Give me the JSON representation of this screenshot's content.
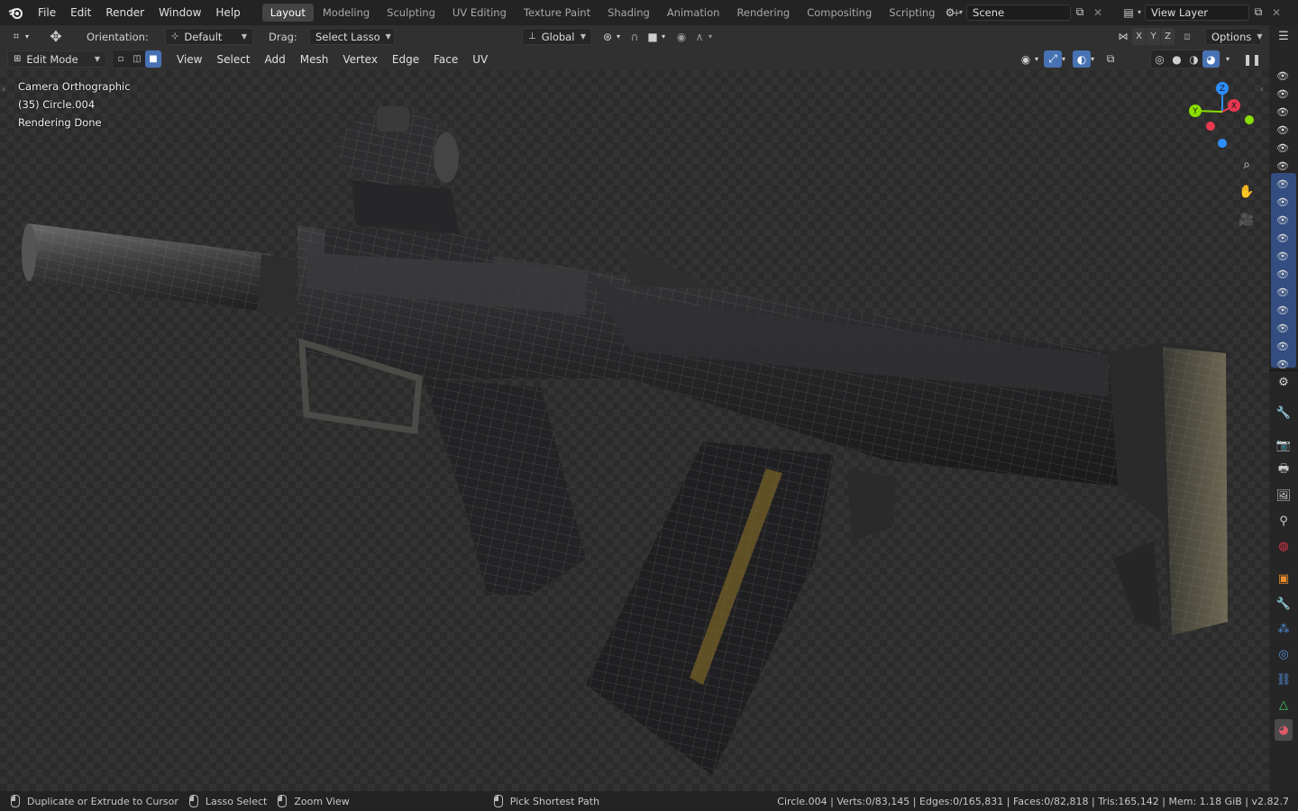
{
  "topbar": {
    "menus": [
      "File",
      "Edit",
      "Render",
      "Window",
      "Help"
    ],
    "workspace_tabs": [
      "Layout",
      "Modeling",
      "Sculpting",
      "UV Editing",
      "Texture Paint",
      "Shading",
      "Animation",
      "Rendering",
      "Compositing",
      "Scripting"
    ],
    "active_tab": "Layout",
    "add_tab": "+",
    "scene_name": "Scene",
    "view_layer_name": "View Layer"
  },
  "tool_header": {
    "orientation_label": "Orientation:",
    "orientation_value": "Default",
    "drag_label": "Drag:",
    "drag_value": "Select Lasso",
    "transform_orientation": "Global",
    "axes": [
      "X",
      "Y",
      "Z"
    ],
    "options_label": "Options"
  },
  "view_header": {
    "mode": "Edit Mode",
    "menus": [
      "View",
      "Select",
      "Add",
      "Mesh",
      "Vertex",
      "Edge",
      "Face",
      "UV"
    ]
  },
  "viewport_overlay": {
    "line1": "Camera Orthographic",
    "line2": "(35) Circle.004",
    "line3": "Rendering Done"
  },
  "gizmo": {
    "x": "X",
    "y": "Y",
    "z": "Z"
  },
  "status_bar": {
    "left_hint": "Duplicate or Extrude to Cursor",
    "middle_hint": "Lasso Select",
    "right_hint": "Zoom View",
    "extra_hint": "Pick Shortest Path",
    "stats": "Circle.004 | Verts:0/83,145 | Edges:0/165,831 | Faces:0/82,818 | Tris:165,142 | Mem: 1.18 GiB | v2.82.7"
  },
  "colors": {
    "accent": "#4772b3",
    "header_bg": "#232323",
    "panel_bg": "#303030",
    "axis_x": "#e8384f",
    "axis_y": "#8bdc00",
    "axis_z": "#2c8fff"
  }
}
